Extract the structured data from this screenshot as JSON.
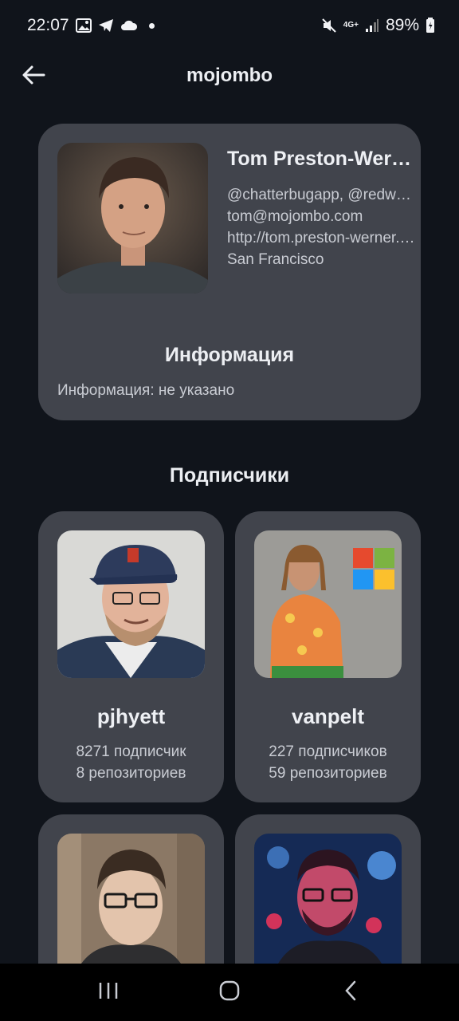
{
  "status_bar": {
    "time": "22:07",
    "battery": "89%",
    "network": "4G+"
  },
  "app_bar": {
    "title": "mojombo",
    "back_icon": "arrow-left-icon"
  },
  "profile": {
    "name": "Tom Preston-Werner",
    "company": "@chatterbugapp, @redwoodjs, @preston-werner-ventures",
    "email": "tom@mojombo.com",
    "blog": "http://tom.preston-werner.com",
    "location": "San Francisco",
    "info_title": "Информация",
    "info_text": "Информация: не указано"
  },
  "followers_section": {
    "title": "Подписчики",
    "items": [
      {
        "login": "pjhyett",
        "followers": "8271 подписчик",
        "repos": "8 репозиториев"
      },
      {
        "login": "vanpelt",
        "followers": "227 подписчиков",
        "repos": "59 репозиториев"
      },
      {
        "login": "",
        "followers": "",
        "repos": ""
      },
      {
        "login": "",
        "followers": "",
        "repos": ""
      }
    ]
  },
  "nav_bar": {
    "recents_icon": "recents-icon",
    "home_icon": "home-icon",
    "back_icon": "nav-back-icon"
  }
}
